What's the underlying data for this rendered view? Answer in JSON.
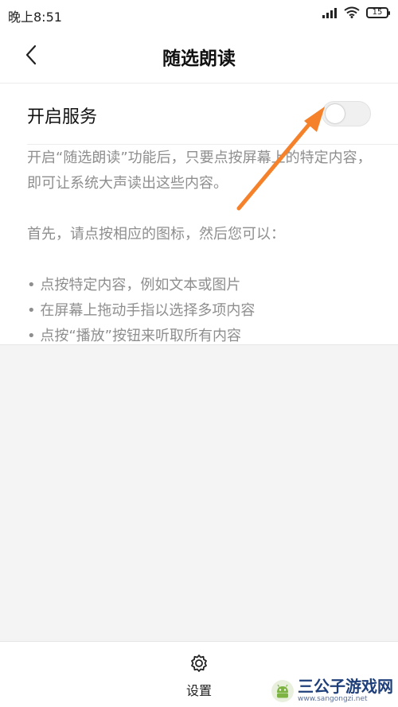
{
  "status_bar": {
    "time": "晚上8:51",
    "battery": "15"
  },
  "header": {
    "title": "随选朗读"
  },
  "service": {
    "label": "开启服务",
    "enabled": false
  },
  "description": {
    "para1": "开启“随选朗读”功能后，只要点按屏幕上的特定内容，即可让系统大声读出这些内容。",
    "para2": "首先，请点按相应的图标，然后您可以：",
    "bullets": [
      "• 点按特定内容，例如文本或图片",
      "• 在屏幕上拖动手指以选择多项内容",
      "• 点按“播放”按钮来听取所有内容"
    ]
  },
  "bottom": {
    "settings_label": "设置"
  },
  "watermark": {
    "title": "三公子游戏网",
    "url": "www.sangongzi.net"
  },
  "colors": {
    "annotation_arrow": "#f5822a",
    "watermark": "#1f3f7a"
  }
}
